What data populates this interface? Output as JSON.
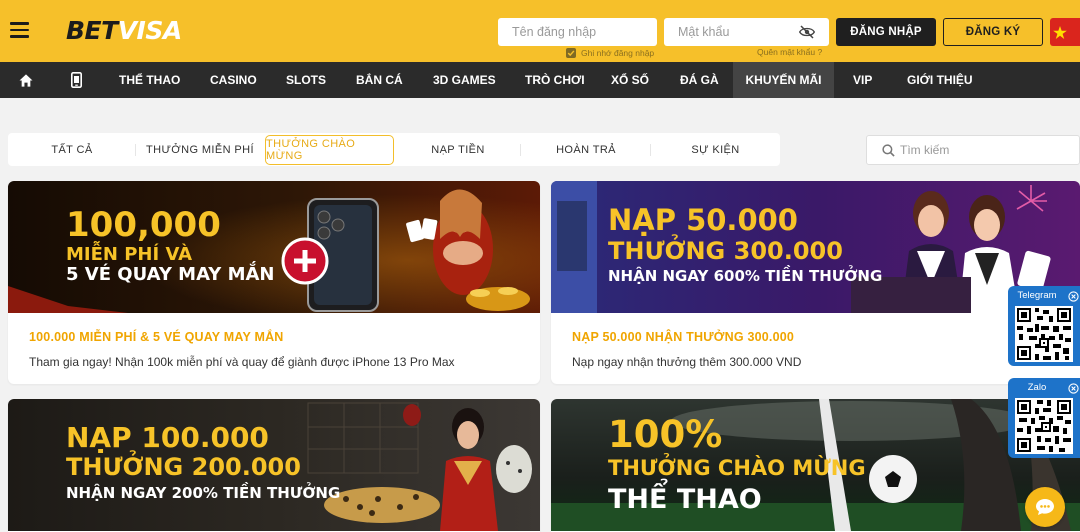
{
  "header": {
    "logo_bet": "BET",
    "logo_visa": "VISA",
    "username_placeholder": "Tên đăng nhập",
    "password_placeholder": "Mật khẩu",
    "remember_label": "Ghi nhớ đăng nhập",
    "forgot_label": "Quên mật khẩu ?",
    "login_label": "ĐĂNG NHẬP",
    "register_label": "ĐĂNG KÝ",
    "accent_color": "#f6c02a"
  },
  "nav": {
    "items": [
      {
        "label": "THỂ THAO"
      },
      {
        "label": "CASINO"
      },
      {
        "label": "SLOTS"
      },
      {
        "label": "BẮN CÁ"
      },
      {
        "label": "3D GAMES"
      },
      {
        "label": "TRÒ CHƠI"
      },
      {
        "label": "XỔ SỐ"
      },
      {
        "label": "ĐÁ GÀ"
      },
      {
        "label": "KHUYẾN MÃI",
        "active": true
      },
      {
        "label": "VIP"
      },
      {
        "label": "GIỚI THIỆU"
      }
    ]
  },
  "filters": {
    "tabs": [
      {
        "label": "TẤT CẢ"
      },
      {
        "label": "THƯỞNG MIỄN PHÍ"
      },
      {
        "label": "THƯỞNG CHÀO MỪNG",
        "active": true
      },
      {
        "label": "NẠP TIỀN"
      },
      {
        "label": "HOÀN TRẢ"
      },
      {
        "label": "SỰ KIỆN"
      }
    ],
    "search_placeholder": "Tìm kiếm"
  },
  "promos": [
    {
      "banner_lines": [
        "100,000",
        "MIỄN PHÍ VÀ",
        "5 VÉ QUAY MAY MẮN"
      ],
      "title": "100.000 MIỄN PHÍ & 5 VÉ QUAY MAY MẮN",
      "description": "Tham gia ngay! Nhận 100k miễn phí và  quay để giành được iPhone 13 Pro Max"
    },
    {
      "banner_lines": [
        "NẠP 50.000",
        "THƯỞNG 300.000",
        "NHẬN NGAY 600% TIỀN THƯỞNG"
      ],
      "title": "NẠP 50.000 NHẬN THƯỞNG 300.000",
      "description": "Nạp ngay nhận thưởng thêm 300.000 VND"
    },
    {
      "banner_lines": [
        "NẠP 100.000",
        "THƯỞNG 200.000",
        "NHẬN NGAY 200% TIỀN THƯỞNG"
      ]
    },
    {
      "banner_lines": [
        "100%",
        "THƯỞNG CHÀO MỪNG",
        "THỂ THAO"
      ]
    }
  ],
  "widgets": {
    "telegram_label": "Telegram",
    "zalo_label": "Zalo"
  }
}
